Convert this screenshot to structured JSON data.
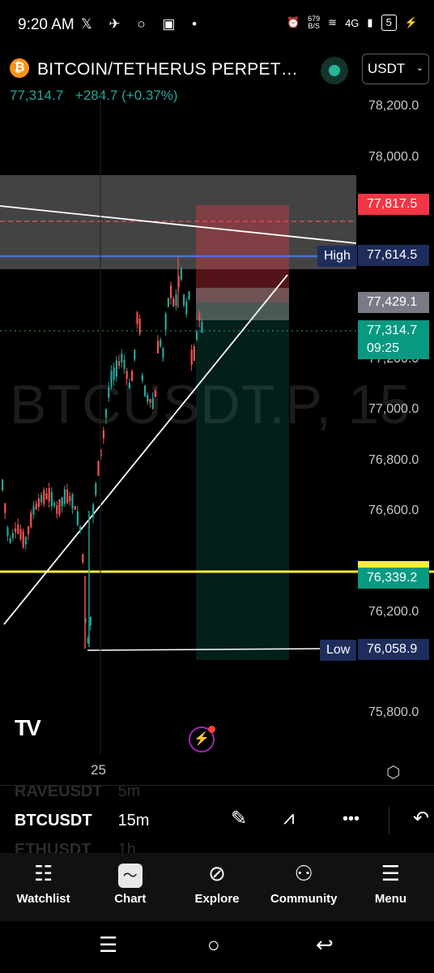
{
  "status_bar": {
    "time": "9:20 AM",
    "left_icons": "𝕏 ✈ ○ ▣ •",
    "speed_value": "679",
    "speed_unit": "B/S",
    "network": "4G",
    "battery": "5"
  },
  "header": {
    "logo_glyph": "₿",
    "title": "BITCOIN/TETHERUS PERPET…",
    "quote_currency": "USDT",
    "last_price": "77,314.7",
    "change": "+284.7 (+0.37%)"
  },
  "chart": {
    "watermark": "BTCUSDT.P, 15",
    "y_axis_ticks": [
      "78,200.0",
      "78,000.0",
      "77,200.0",
      "77,000.0",
      "76,800.0",
      "76,600.0",
      "76,200.0",
      "75,800.0"
    ],
    "price_tags": [
      {
        "text": "77,817.5",
        "bg": "#f23645",
        "color": "#ffffff"
      },
      {
        "text": "77,614.5",
        "bg": "#1e2d5c",
        "color": "#ffffff"
      },
      {
        "text": "77,429.1",
        "bg": "#787b86",
        "color": "#ffffff"
      },
      {
        "text": "77,314.7",
        "bg": "#089981",
        "color": "#ffffff"
      },
      {
        "text": "09:25",
        "bg": "#089981",
        "color": "#ffffff"
      },
      {
        "text": "76,339.2",
        "bg": "#089981",
        "color": "#ffffff"
      },
      {
        "text": "76,058.9",
        "bg": "#1e2d5c",
        "color": "#ffffff"
      }
    ],
    "high_label": "High",
    "low_label": "Low",
    "x_label": "25",
    "colors": {
      "up": "#26a69a",
      "down": "#ef5350",
      "yellow_line": "#ffeb3b",
      "blue_line": "#4a6fd8"
    }
  },
  "watchlist_peek": {
    "rows": [
      {
        "symbol": "RAVEUSDT",
        "interval": "5m"
      },
      {
        "symbol": "BTCUSDT",
        "interval": "15m"
      },
      {
        "symbol": "ETHUSDT",
        "interval": "1h"
      }
    ]
  },
  "bottom_nav": [
    {
      "label": "Watchlist",
      "icon": "watchlist-icon"
    },
    {
      "label": "Chart",
      "icon": "chart-icon"
    },
    {
      "label": "Explore",
      "icon": "compass-icon"
    },
    {
      "label": "Community",
      "icon": "people-icon"
    },
    {
      "label": "Menu",
      "icon": "menu-icon"
    }
  ]
}
